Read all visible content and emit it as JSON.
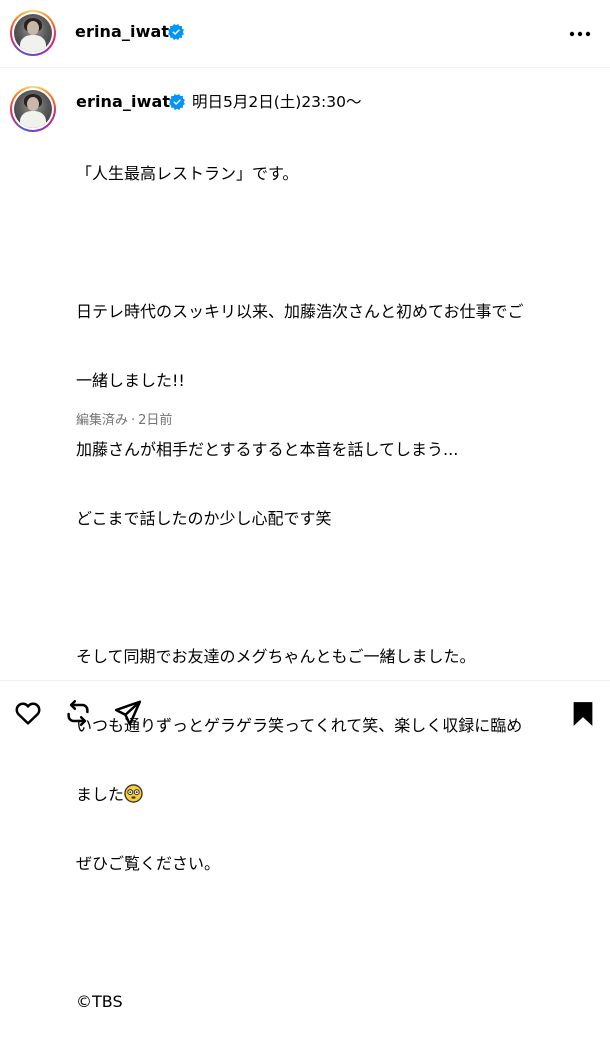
{
  "header": {
    "username": "erina_iwata",
    "more_icon": "more-horizontal-icon"
  },
  "post": {
    "username": "erina_iwata",
    "timestamp": "明日5月2日(土)23:30〜",
    "caption_lines": [
      "「人生最高レストラン」です。",
      "",
      "日テレ時代のスッキリ以来、加藤浩次さんと初めてお仕事でご",
      "一緒しました!!",
      "加藤さんが相手だとするすると本音を話してしまう...",
      "どこまで話したのか少し心配です笑",
      "",
      "そして同期でお友達のメグちゃんともご一緒しました。",
      "いつも通りずっとゲラゲラ笑ってくれて笑、楽しく収録に臨め",
      "ました",
      "ぜひご覧ください。",
      "",
      "©TBS"
    ],
    "edited_label": "編集済み",
    "separator": "·",
    "age": "2日前"
  },
  "footer": {
    "icons": [
      "heart-icon",
      "repost-icon",
      "share-icon",
      "bookmark-icon"
    ]
  },
  "colors": {
    "verified": "#0095f6",
    "muted_text": "#737373",
    "divider": "#efefef"
  }
}
